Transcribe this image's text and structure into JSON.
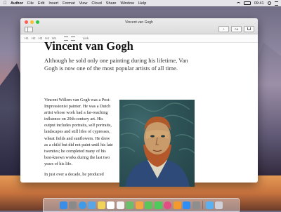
{
  "menubar": {
    "app_name": "Author",
    "items": [
      "File",
      "Edit",
      "Insert",
      "Format",
      "View",
      "Cloud",
      "Share",
      "Window",
      "Help"
    ],
    "clock": "09:41"
  },
  "window": {
    "title": "Vincent van Gogh",
    "toolbar_right": [
      "+",
      "Aa",
      ""
    ]
  },
  "formatbar": {
    "headings": [
      "H1",
      "H2",
      "H3",
      "H4",
      "H5"
    ],
    "link_label": "Link"
  },
  "document": {
    "title": "Vincent van Gogh",
    "subtitle": "Although he sold only one painting during his lifetime, Van Gogh is now one of the most popular artists of all time.",
    "paragraphs": [
      "Vincent Willem van Gogh was a Post-Impressionist painter. He was a Dutch artist whose work had a far-reaching influence on 20th-century art. His output includes portraits, self portraits, landscapes and still lifes of cypresses, wheat fields and sunflowers. He drew as a child but did not paint until his late twenties; he completed many of his best-known works during the last two years of his life.",
      "In just over a decade, he produced"
    ]
  },
  "dock": {
    "icons": [
      "finder-icon",
      "launchpad-icon",
      "safari-icon",
      "mail-icon",
      "notes-icon",
      "calendar-icon",
      "reminders-icon",
      "maps-icon",
      "photos-icon",
      "messages-icon",
      "facetime-icon",
      "itunes-icon",
      "ibooks-icon",
      "app-store-icon",
      "system-preferences-icon",
      "folder-icon",
      "trash-icon"
    ],
    "colors": [
      "#3b8ee8",
      "#8a8a8a",
      "#3f9be8",
      "#5aa5e6",
      "#f1d35a",
      "#ffffff",
      "#f4f4f4",
      "#6cbf6a",
      "#f4a640",
      "#5ac55a",
      "#4ecb5a",
      "#e24d84",
      "#f39a2e",
      "#2f8ef5",
      "#8e8e8e",
      "#5ab0f0",
      "#d0d0d8"
    ]
  }
}
